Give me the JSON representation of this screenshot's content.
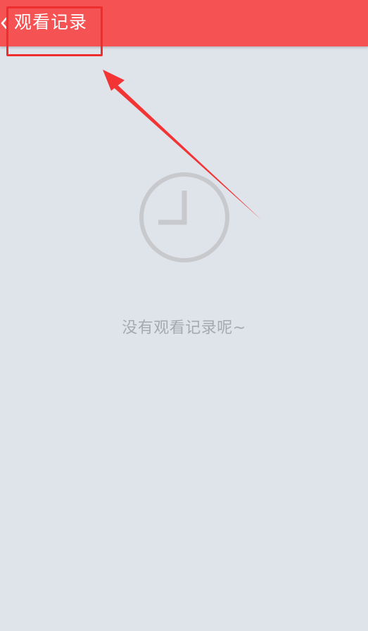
{
  "header": {
    "title": "观看记录",
    "back_icon": "chevron-left-icon",
    "background_color": "#f55353"
  },
  "empty_state": {
    "icon": "clock-icon",
    "message": "没有观看记录呢~"
  },
  "annotation": {
    "color": "#f02d2d"
  }
}
